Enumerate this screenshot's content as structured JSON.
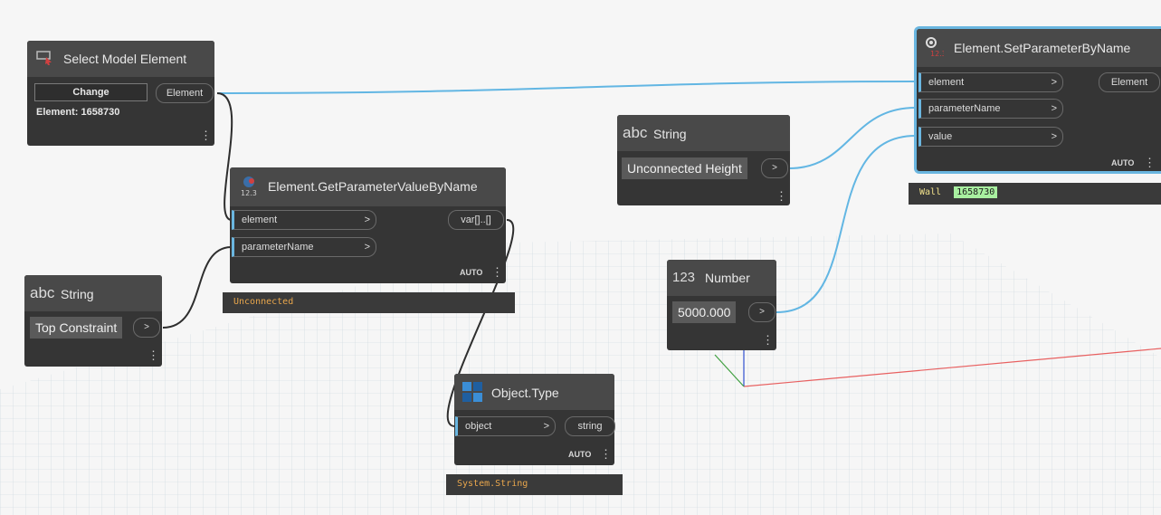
{
  "select_model_element": {
    "title": "Select Model Element",
    "change_button": "Change",
    "output_port": "Element",
    "element_info": "Element: 1658730"
  },
  "get_parameter": {
    "title": "Element.GetParameterValueByName",
    "inputs": [
      "element",
      "parameterName"
    ],
    "output_port": "var[]..[]",
    "lacing": "AUTO",
    "preview": "Unconnected"
  },
  "string_top": {
    "title": "String",
    "type_glyph": "abc",
    "value": "Top Constraint",
    "output_arrow": ">"
  },
  "string_unconnected": {
    "title": "String",
    "type_glyph": "abc",
    "value": "Unconnected Height",
    "output_arrow": ">"
  },
  "number_node": {
    "title": "Number",
    "type_glyph": "123",
    "value": "5000.000",
    "output_arrow": ">"
  },
  "object_type": {
    "title": "Object.Type",
    "inputs": [
      "object"
    ],
    "output_port": "string",
    "lacing": "AUTO",
    "preview": "System.String"
  },
  "set_parameter": {
    "title": "Element.SetParameterByName",
    "inputs": [
      "element",
      "parameterName",
      "value"
    ],
    "output_port": "Element",
    "lacing": "AUTO",
    "preview_label": "Wall",
    "preview_value": "1658730"
  },
  "port_arrow": ">",
  "menu_glyph": "⋮",
  "colors": {
    "wire": "#62b6e3",
    "node_body": "#353535",
    "node_header": "#494949",
    "selection_outline": "#6ab6e0",
    "preview_text": "#e8a64c",
    "preview_value_bg": "#a8f0a0"
  }
}
